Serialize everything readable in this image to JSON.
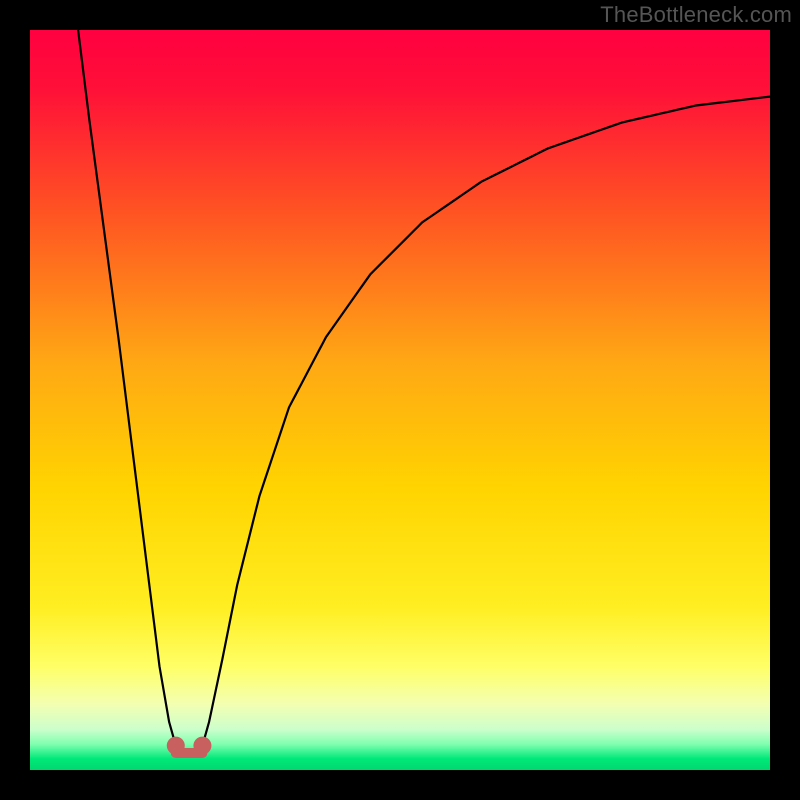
{
  "watermark": "TheBottleneck.com",
  "chart_data": {
    "type": "line",
    "title": "",
    "xlabel": "",
    "ylabel": "",
    "xlim": [
      0,
      100
    ],
    "ylim": [
      0,
      100
    ],
    "grid": false,
    "legend": false,
    "background_gradient": {
      "type": "vertical",
      "stops": [
        {
          "pos": 0.0,
          "color": "#ff0040"
        },
        {
          "pos": 0.08,
          "color": "#ff1038"
        },
        {
          "pos": 0.25,
          "color": "#ff5522"
        },
        {
          "pos": 0.45,
          "color": "#ffa814"
        },
        {
          "pos": 0.62,
          "color": "#ffd400"
        },
        {
          "pos": 0.78,
          "color": "#ffee22"
        },
        {
          "pos": 0.86,
          "color": "#ffff66"
        },
        {
          "pos": 0.91,
          "color": "#f4ffb0"
        },
        {
          "pos": 0.945,
          "color": "#ccffcc"
        },
        {
          "pos": 0.965,
          "color": "#80ffb0"
        },
        {
          "pos": 0.985,
          "color": "#00e878"
        },
        {
          "pos": 1.0,
          "color": "#00d870"
        }
      ]
    },
    "series": [
      {
        "name": "curve-left",
        "stroke": "#000000",
        "x": [
          6.5,
          8.0,
          10.0,
          12.0,
          14.0,
          16.0,
          17.5,
          18.8,
          19.7
        ],
        "y": [
          100.0,
          88.0,
          73.0,
          58.0,
          42.0,
          26.0,
          14.0,
          6.5,
          3.3
        ]
      },
      {
        "name": "curve-right",
        "stroke": "#000000",
        "x": [
          23.3,
          24.2,
          26.0,
          28.0,
          31.0,
          35.0,
          40.0,
          46.0,
          53.0,
          61.0,
          70.0,
          80.0,
          90.0,
          100.0
        ],
        "y": [
          3.3,
          6.5,
          15.0,
          25.0,
          37.0,
          49.0,
          58.5,
          67.0,
          74.0,
          79.5,
          84.0,
          87.5,
          89.8,
          91.0
        ]
      }
    ],
    "markers": [
      {
        "name": "left-endpoint",
        "x": 19.7,
        "y": 3.3,
        "color": "#c86060",
        "r": 9
      },
      {
        "name": "right-endpoint",
        "x": 23.3,
        "y": 3.3,
        "color": "#c86060",
        "r": 9
      }
    ],
    "connector": {
      "from": {
        "x": 19.7,
        "y": 2.3
      },
      "to": {
        "x": 23.3,
        "y": 2.3
      },
      "stroke": "#c86060",
      "width": 10
    }
  }
}
